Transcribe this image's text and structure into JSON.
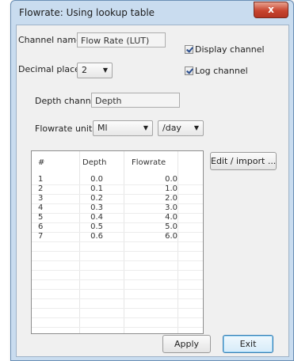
{
  "window": {
    "title": "Flowrate: Using lookup table",
    "close_glyph": "x"
  },
  "form": {
    "channel_name_label": "Channel name",
    "channel_name_value": "Flow Rate (LUT)",
    "decimal_places_label": "Decimal places",
    "decimal_places_value": "2",
    "display_channel_label": "Display channel",
    "display_channel_checked": true,
    "log_channel_label": "Log channel",
    "log_channel_checked": true,
    "depth_channel_label": "Depth channel",
    "depth_channel_value": "Depth",
    "flowrate_units_label": "Flowrate units",
    "flowrate_unit_value": "Ml",
    "flowrate_per_value": "/day"
  },
  "table": {
    "columns": [
      "#",
      "Depth",
      "Flowrate"
    ],
    "rows": [
      {
        "idx": "1",
        "depth": "0.0",
        "flowrate": "0.0"
      },
      {
        "idx": "2",
        "depth": "0.1",
        "flowrate": "1.0"
      },
      {
        "idx": "3",
        "depth": "0.2",
        "flowrate": "2.0"
      },
      {
        "idx": "4",
        "depth": "0.3",
        "flowrate": "3.0"
      },
      {
        "idx": "5",
        "depth": "0.4",
        "flowrate": "4.0"
      },
      {
        "idx": "6",
        "depth": "0.5",
        "flowrate": "5.0"
      },
      {
        "idx": "7",
        "depth": "0.6",
        "flowrate": "6.0"
      }
    ]
  },
  "buttons": {
    "edit_import": "Edit / import ...",
    "apply": "Apply",
    "exit": "Exit"
  },
  "icons": {
    "combo_arrow": "chevron-down-icon",
    "check": "checkmark-icon",
    "close": "close-icon"
  },
  "colors": {
    "title_bar": "#c9dcef",
    "close_button": "#c8452f",
    "default_button_border": "#3c7fb1"
  }
}
